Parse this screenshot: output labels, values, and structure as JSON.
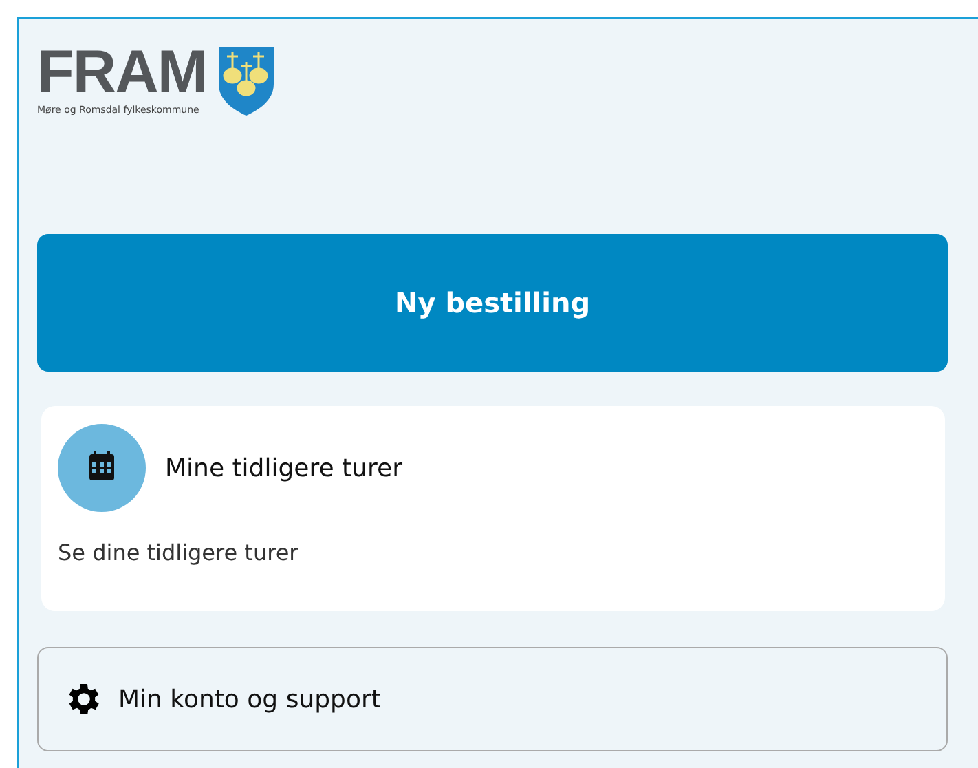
{
  "logo": {
    "wordmark": "FRAM",
    "subtitle": "Møre og Romsdal fylkeskommune"
  },
  "primary_button": {
    "label": "Ny bestilling"
  },
  "card": {
    "title": "Mine tidligere turer",
    "description": "Se dine tidligere turer"
  },
  "account_button": {
    "label": "Min konto og support"
  }
}
